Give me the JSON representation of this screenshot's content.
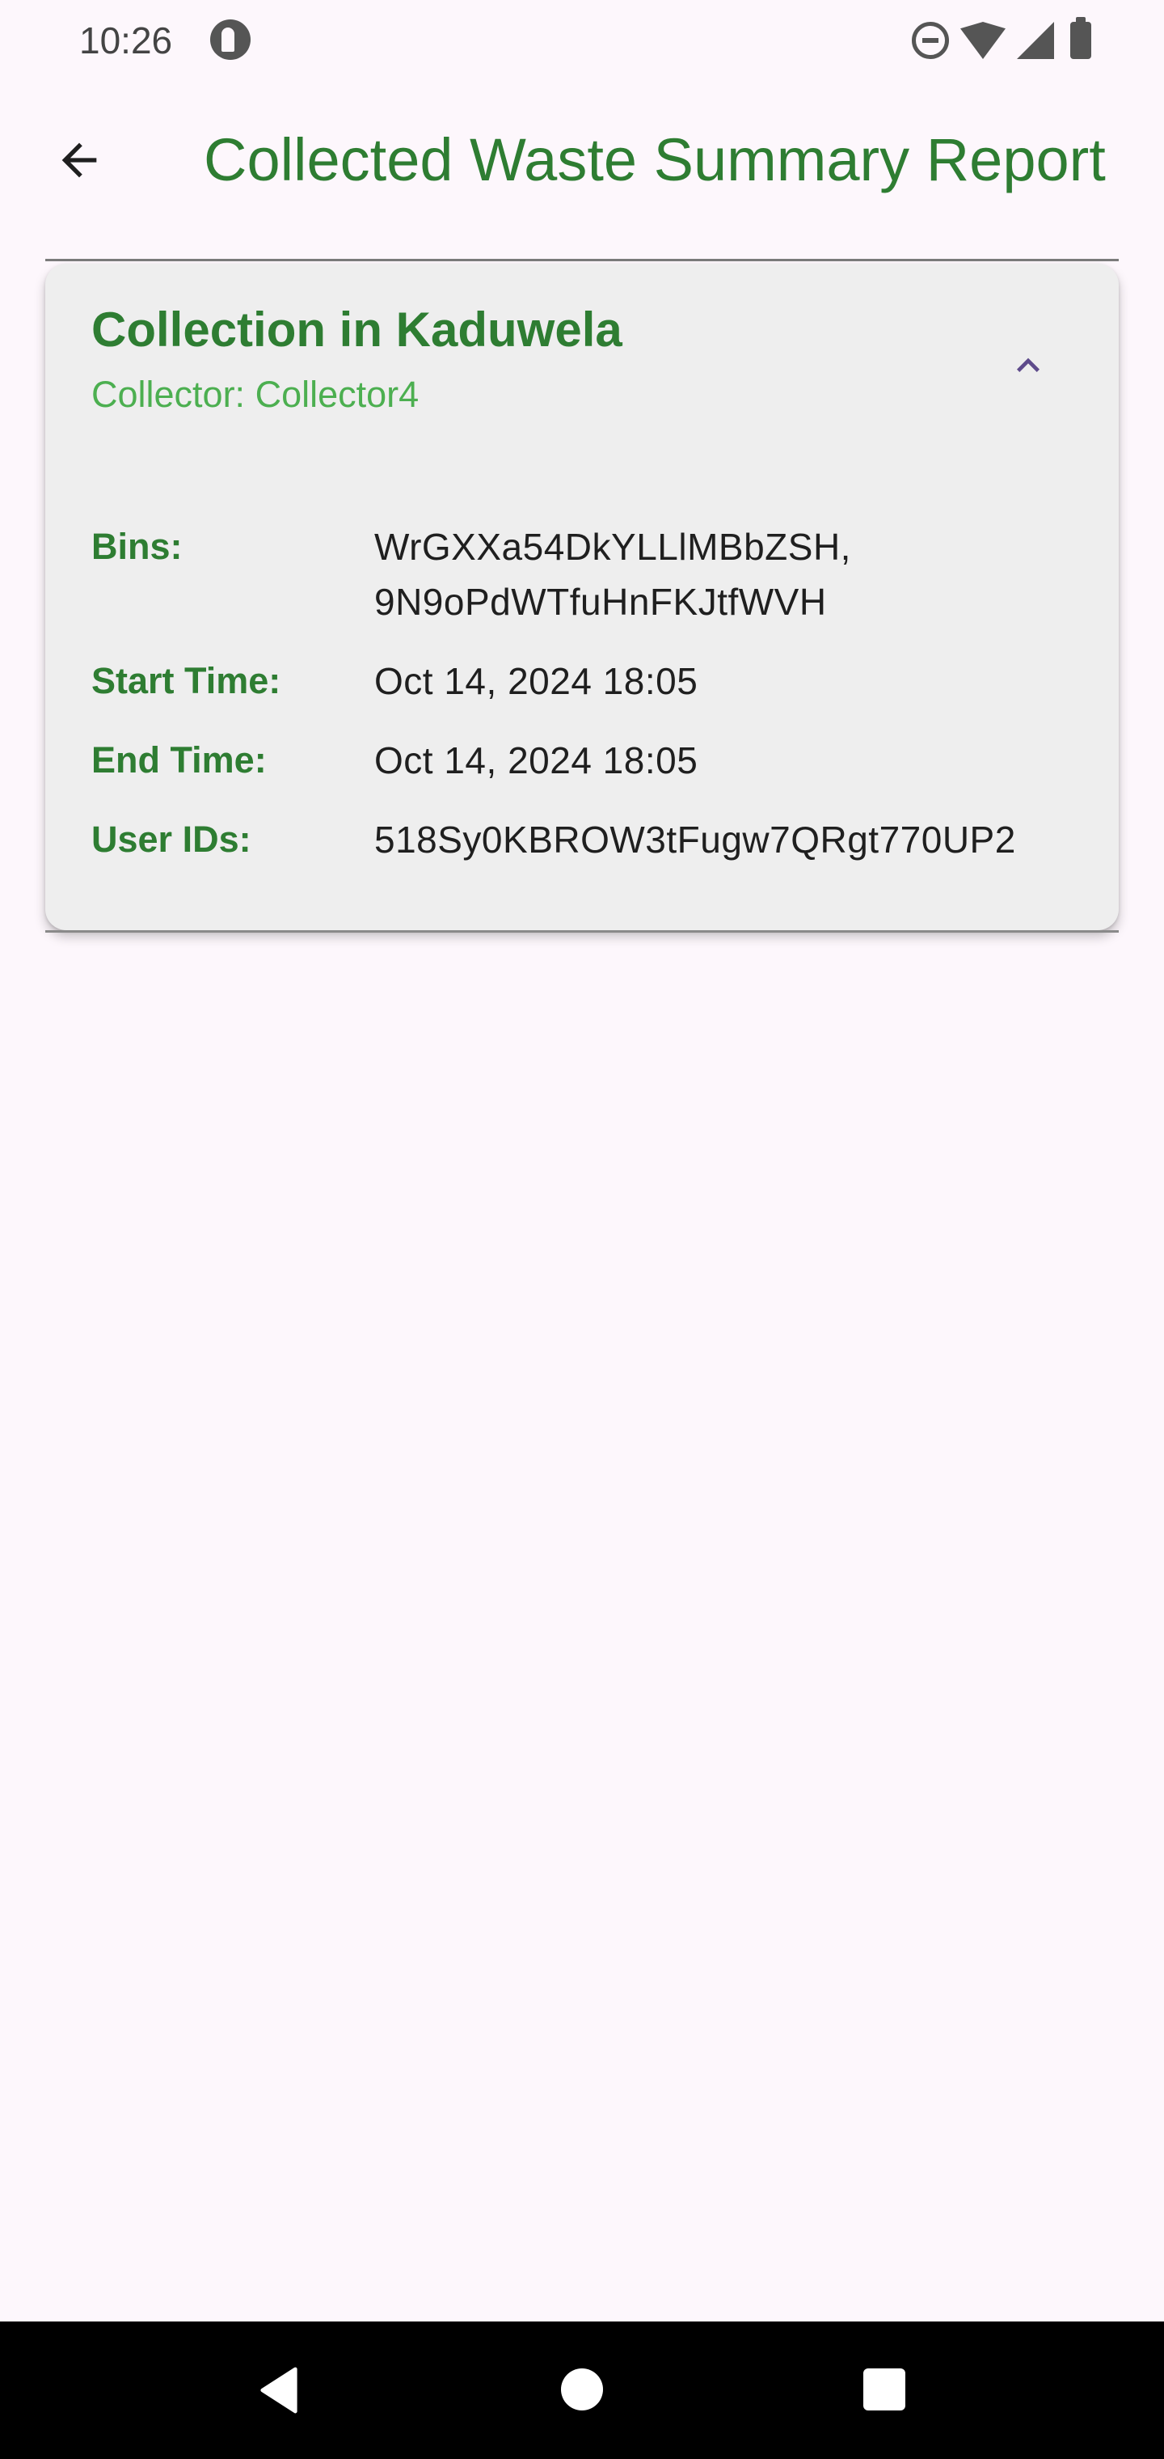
{
  "status_bar": {
    "time": "10:26",
    "icons": [
      "app-notification-icon",
      "do-not-disturb-icon",
      "wifi-icon",
      "cellular-signal-icon",
      "battery-icon"
    ]
  },
  "app_bar": {
    "back_icon": "arrow-back-icon",
    "title": "Collected Waste Summary Report"
  },
  "card": {
    "title": "Collection in Kaduwela",
    "subtitle": "Collector: Collector4",
    "expand_icon": "chevron-up-icon",
    "expanded": true,
    "details": {
      "bins_label": "Bins:",
      "bins_line1": "WrGXXa54DkYLLlMBbZSH,",
      "bins_line2": "9N9oPdWTfuHnFKJtfWVH",
      "start_time_label": "Start Time:",
      "start_time_value": "Oct 14, 2024 18:05",
      "end_time_label": "End Time:",
      "end_time_value": "Oct 14, 2024 18:05",
      "user_ids_label": "User IDs:",
      "user_ids_value": "518Sy0KBROW3tFugw7QRgt770UP2"
    }
  },
  "nav_bar": {
    "icons": [
      "nav-back-icon",
      "nav-home-icon",
      "nav-recents-icon"
    ]
  },
  "colors": {
    "background": "#fdf7fc",
    "primary_green": "#2e7d32",
    "secondary_green": "#4caf50",
    "card_background": "#eeeeee",
    "accent_purple": "#5e4b8b"
  }
}
